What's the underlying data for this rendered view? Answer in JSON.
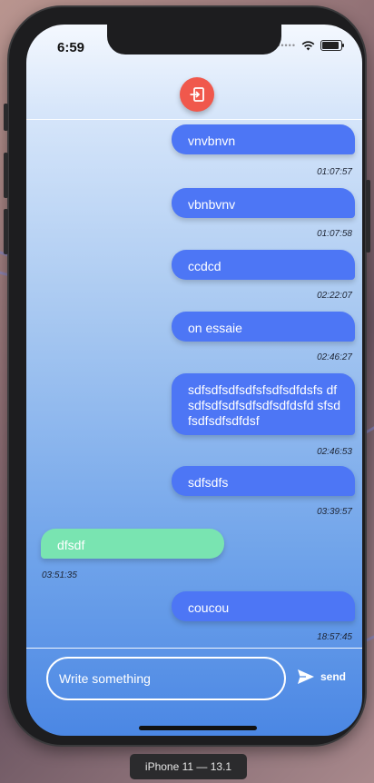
{
  "status_bar": {
    "time": "6:59",
    "signal_dots": "•••••"
  },
  "header": {
    "logout_icon": "exit-door-icon",
    "accent": "#f0584c"
  },
  "messages": [
    {
      "text": "vnvbnvn",
      "time": "01:07:57",
      "side": "sent"
    },
    {
      "text": "vbnbvnv",
      "time": "01:07:58",
      "side": "sent"
    },
    {
      "text": "ccdcd",
      "time": "02:22:07",
      "side": "sent"
    },
    {
      "text": "on essaie",
      "time": "02:46:27",
      "side": "sent"
    },
    {
      "text": "sdfsdfsdfsdfsfsdfsdfdsfs dfsdfsdfsdfsdfsdfsdfdsfd sfsdfsdfsdfsdfdsf",
      "time": "02:46:53",
      "side": "sent"
    },
    {
      "text": "sdfsdfs",
      "time": "03:39:57",
      "side": "sent"
    },
    {
      "text": "dfsdf",
      "time": "03:51:35",
      "side": "received"
    },
    {
      "text": "coucou",
      "time": "18:57:45",
      "side": "sent"
    }
  ],
  "composer": {
    "placeholder": "Write something",
    "send_label": "send",
    "send_icon": "paper-plane-icon"
  },
  "colors": {
    "sent_bubble": "#4d76f5",
    "received_bubble": "#79e4b1"
  },
  "device_caption": "iPhone 11 — 13.1"
}
